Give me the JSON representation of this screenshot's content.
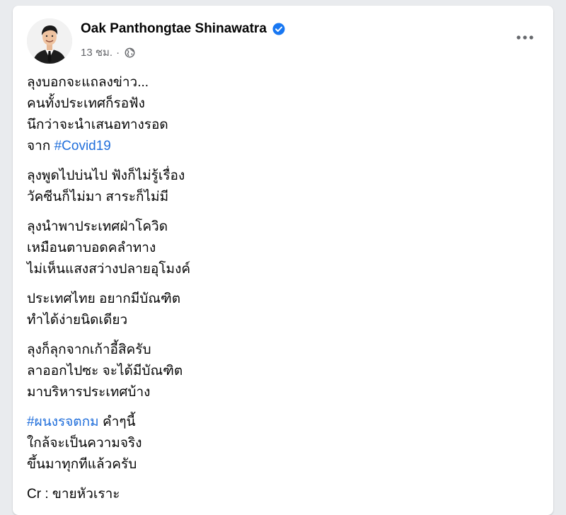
{
  "post": {
    "author": "Oak Panthongtae Shinawatra",
    "verified": true,
    "timestamp": "13 ชม.",
    "separator": "·",
    "audience_icon": "globe-icon",
    "more_icon": "more-options-icon",
    "hashtag_color": "#216fdb",
    "paragraphs": [
      {
        "lines": [
          {
            "text": "ลุงบอกจะแถลงข่าว..."
          },
          {
            "text": "คนทั้งประเทศก็รอฟัง"
          },
          {
            "text": "นึกว่าจะนำเสนอทางรอด"
          },
          {
            "text": "จาก ",
            "hashtag": "#Covid19",
            "after": ""
          }
        ]
      },
      {
        "lines": [
          {
            "text": "ลุงพูดไปบ่นไป ฟังก็ไม่รู้เรื่อง"
          },
          {
            "text": "วัคซีนก็ไม่มา สาระก็ไม่มี"
          }
        ]
      },
      {
        "lines": [
          {
            "text": "ลุงนำพาประเทศฝ่าโควิด"
          },
          {
            "text": "เหมือนตาบอดคลำทาง"
          },
          {
            "text": "ไม่เห็นแสงสว่างปลายอุโมงค์"
          }
        ]
      },
      {
        "lines": [
          {
            "text": "ประเทศไทย อยากมีบัณฑิต"
          },
          {
            "text": "ทำได้ง่ายนิดเดียว"
          }
        ]
      },
      {
        "lines": [
          {
            "text": "ลุงก็ลุกจากเก้าอี้สิครับ"
          },
          {
            "text": "ลาออกไปซะ จะได้มีบัณฑิต"
          },
          {
            "text": "มาบริหารประเทศบ้าง"
          }
        ]
      },
      {
        "lines": [
          {
            "text": "",
            "hashtag": "#ผนงรจตกม",
            "after": " คำๆนี้"
          },
          {
            "text": "ใกล้จะเป็นความจริง"
          },
          {
            "text": "ขึ้นมาทุกทีแล้วครับ"
          }
        ]
      },
      {
        "lines": [
          {
            "text": "Cr : ขายหัวเราะ"
          }
        ]
      }
    ]
  }
}
